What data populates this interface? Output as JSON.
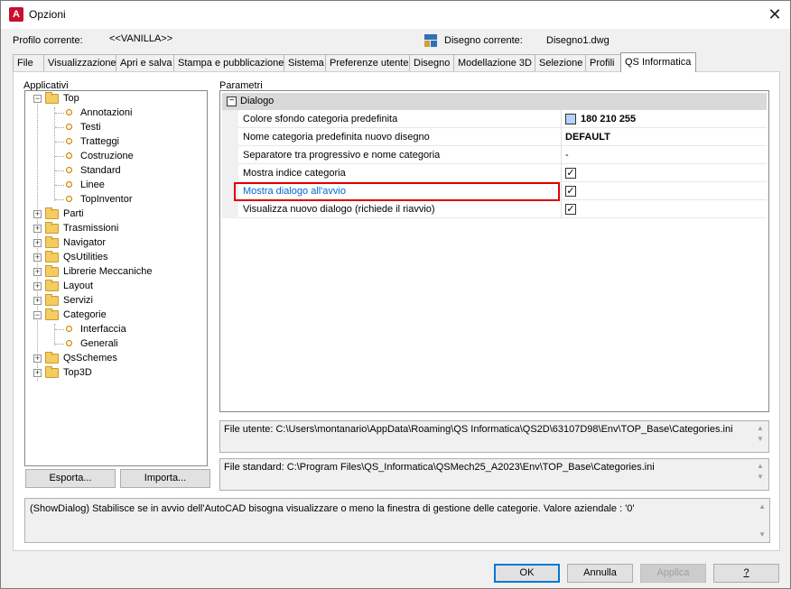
{
  "window": {
    "title": "Opzioni",
    "app_icon_letter": "A",
    "close_symbol": "✕"
  },
  "profile": {
    "label": "Profilo corrente:",
    "value": "<<VANILLA>>",
    "drawing_label": "Disegno corrente:",
    "drawing_value": "Disegno1.dwg"
  },
  "tabs": [
    {
      "label": "File"
    },
    {
      "label": "Visualizzazione"
    },
    {
      "label": "Apri e salva"
    },
    {
      "label": "Stampa e pubblicazione"
    },
    {
      "label": "Sistema"
    },
    {
      "label": "Preferenze utente"
    },
    {
      "label": "Disegno"
    },
    {
      "label": "Modellazione 3D"
    },
    {
      "label": "Selezione"
    },
    {
      "label": "Profili"
    },
    {
      "label": "QS Informatica",
      "active": true
    }
  ],
  "applicativi": {
    "title": "Applicativi",
    "tree": [
      {
        "label": "Top",
        "type": "folder",
        "expander": "−"
      },
      {
        "label": "Annotazioni",
        "type": "leaf"
      },
      {
        "label": "Testi",
        "type": "leaf"
      },
      {
        "label": "Tratteggi",
        "type": "leaf"
      },
      {
        "label": "Costruzione",
        "type": "leaf"
      },
      {
        "label": "Standard",
        "type": "leaf"
      },
      {
        "label": "Linee",
        "type": "leaf"
      },
      {
        "label": "TopInventor",
        "type": "leaf"
      },
      {
        "label": "Parti",
        "type": "folder",
        "expander": "+"
      },
      {
        "label": "Trasmissioni",
        "type": "folder",
        "expander": "+"
      },
      {
        "label": "Navigator",
        "type": "folder",
        "expander": "+"
      },
      {
        "label": "QsUtilities",
        "type": "folder",
        "expander": "+"
      },
      {
        "label": "Librerie Meccaniche",
        "type": "folder",
        "expander": "+"
      },
      {
        "label": "Layout",
        "type": "folder",
        "expander": "+"
      },
      {
        "label": "Servizi",
        "type": "folder",
        "expander": "+"
      },
      {
        "label": "Categorie",
        "type": "folder",
        "expander": "−"
      },
      {
        "label": "Interfaccia",
        "type": "leaf"
      },
      {
        "label": "Generali",
        "type": "leaf"
      },
      {
        "label": "QsSchemes",
        "type": "folder",
        "expander": "+"
      },
      {
        "label": "Top3D",
        "type": "folder",
        "expander": "+"
      }
    ],
    "export_button": "Esporta...",
    "import_button": "Importa..."
  },
  "parametri": {
    "title": "Parametri",
    "category": "Dialogo",
    "category_toggle": "−",
    "properties": [
      {
        "name": "Colore sfondo categoria predefinita",
        "value": "180 210 255",
        "kind": "color",
        "swatch": "#b4d2ff"
      },
      {
        "name": "Nome categoria predefinita nuovo disegno",
        "value": "DEFAULT",
        "kind": "text-bold"
      },
      {
        "name": "Separatore tra progressivo e nome categoria",
        "value": "-",
        "kind": "text"
      },
      {
        "name": "Mostra indice categoria",
        "value": "✓",
        "kind": "checkbox"
      },
      {
        "name": "Mostra dialogo all'avvio",
        "value": "✓",
        "kind": "checkbox",
        "selected": true
      },
      {
        "name": "Visualizza nuovo dialogo (richiede il riavvio)",
        "value": "✓",
        "kind": "checkbox"
      }
    ]
  },
  "files": {
    "user": "File utente: C:\\Users\\montanario\\AppData\\Roaming\\QS Informatica\\QS2D\\63107D98\\Env\\TOP_Base\\Categories.ini",
    "standard": "File standard: C:\\Program Files\\QS_Informatica\\QSMech25_A2023\\Env\\TOP_Base\\Categories.ini"
  },
  "description": "(ShowDialog) Stabilisce se in avvio dell'AutoCAD bisogna visualizzare o meno la finestra di gestione delle categorie. Valore aziendale : '0'",
  "footer": {
    "ok": "OK",
    "cancel": "Annulla",
    "apply": "Applica",
    "help": "?"
  },
  "colors": {
    "highlight_border": "#e00000",
    "selected_text": "#0066cc",
    "accent": "#0078d7"
  }
}
